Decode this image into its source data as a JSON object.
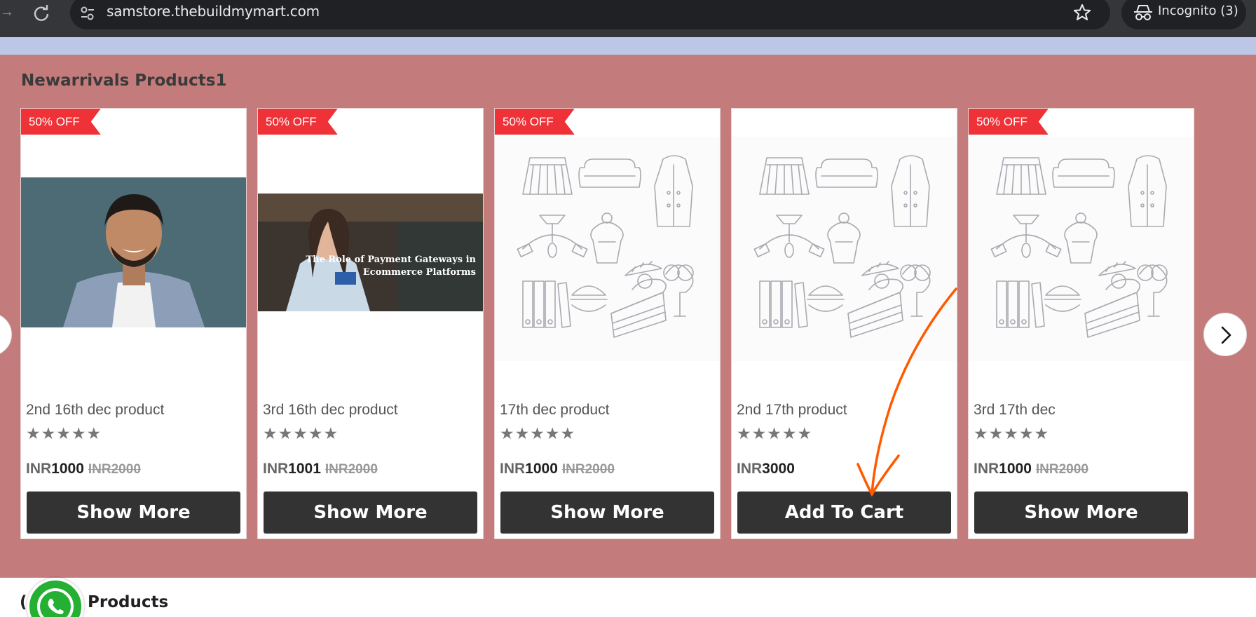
{
  "browser": {
    "url": "samstore.thebuildmymart.com",
    "incognito_label": "Incognito (3)"
  },
  "section": {
    "title": "Newarrivals Products1",
    "bg_color": "#c47b7b"
  },
  "products": [
    {
      "badge": "50% OFF",
      "name": "2nd 16th dec product",
      "stars": "★★★★★",
      "currency": "INR",
      "price": "1000",
      "old_price": "INR2000",
      "button": "Show More",
      "image": "man-portrait"
    },
    {
      "badge": "50% OFF",
      "name": "3rd 16th dec product",
      "stars": "★★★★★",
      "currency": "INR",
      "price": "1001",
      "old_price": "INR2000",
      "button": "Show More",
      "image": "payment-gateway-banner",
      "image_caption_line1": "The Role of Payment Gateways in",
      "image_caption_line2": "Ecommerce Platforms"
    },
    {
      "badge": "50% OFF",
      "name": "17th dec product",
      "stars": "★★★★★",
      "currency": "INR",
      "price": "1000",
      "old_price": "INR2000",
      "button": "Show More",
      "image": "placeholder-sketches"
    },
    {
      "badge": "",
      "name": "2nd 17th product",
      "stars": "★★★★★",
      "currency": "INR",
      "price": "3000",
      "old_price": "",
      "button": "Add To Cart",
      "image": "placeholder-sketches"
    },
    {
      "badge": "50% OFF",
      "name": "3rd 17th dec",
      "stars": "★★★★★",
      "currency": "INR",
      "price": "1000",
      "old_price": "INR2000",
      "button": "Show More",
      "image": "placeholder-sketches"
    }
  ],
  "next_section": {
    "title": "Products",
    "left_fragment": "("
  },
  "colors": {
    "badge": "#ee3238",
    "button": "#333333",
    "annotation_arrow": "#ff5a00",
    "whatsapp": "#25b034"
  }
}
